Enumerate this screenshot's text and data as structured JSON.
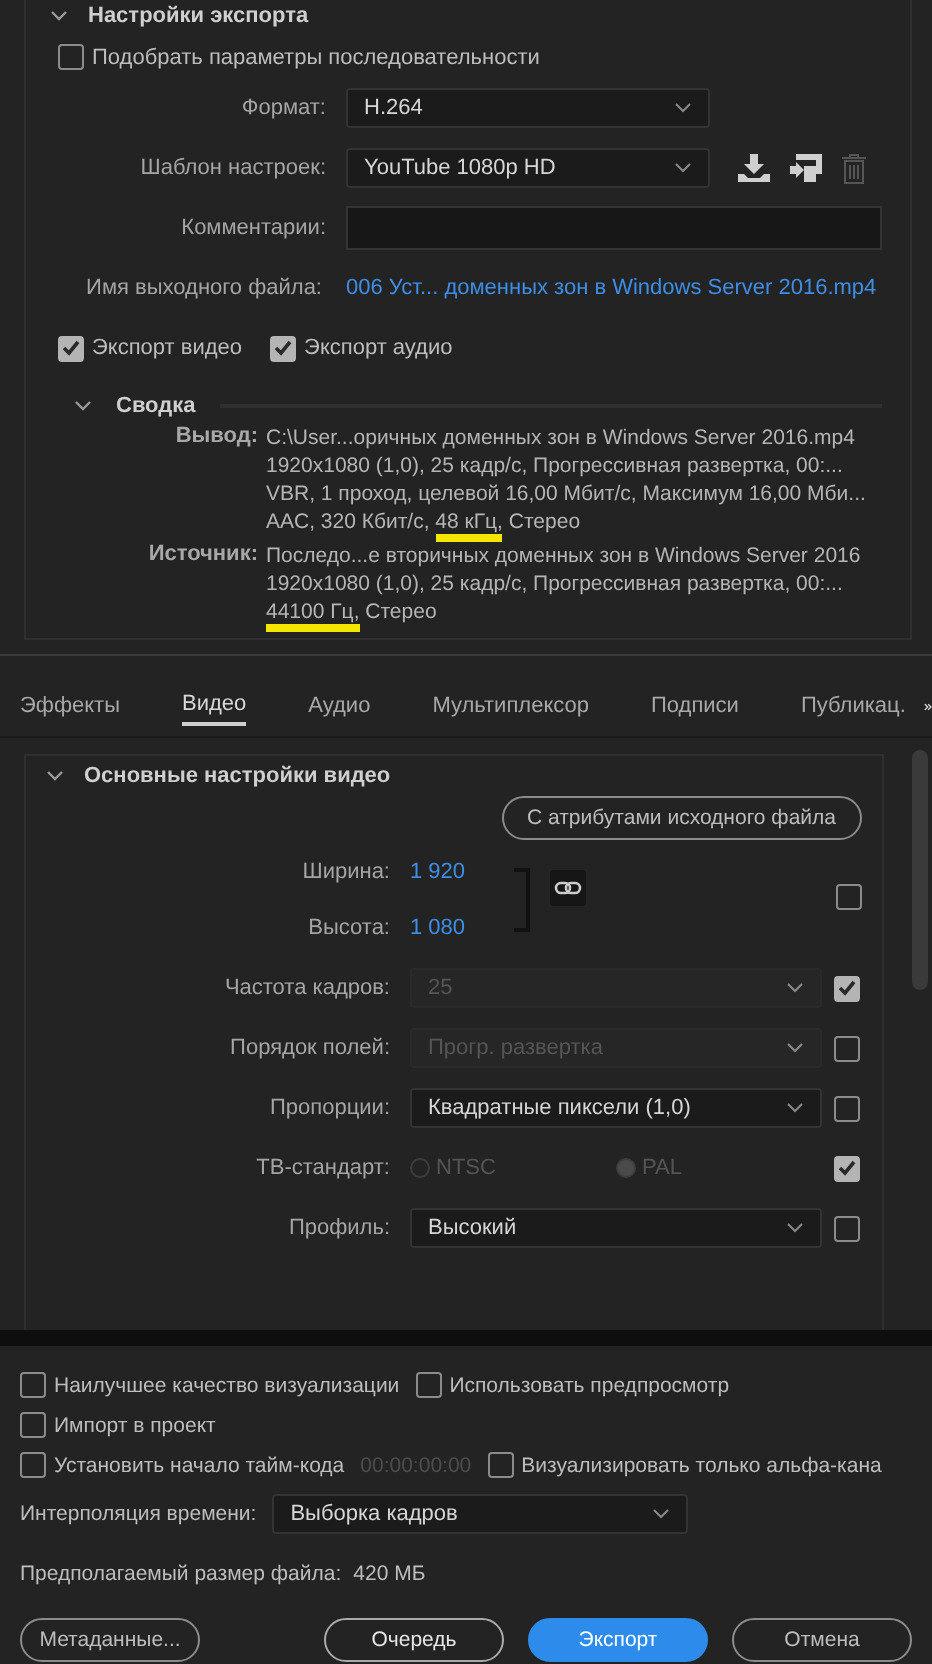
{
  "export_settings": {
    "title": "Настройки экспорта",
    "expanded": true,
    "match_sequence": {
      "label": "Подобрать параметры последовательности",
      "checked": false
    },
    "format": {
      "label": "Формат:",
      "value": "H.264"
    },
    "preset": {
      "label": "Шаблон настроек:",
      "value": "YouTube 1080p HD"
    },
    "comments": {
      "label": "Комментарии:"
    },
    "output_name": {
      "label": "Имя выходного файла:",
      "value": "006 Уст... доменных зон в Windows Server 2016.mp4"
    },
    "export_video": {
      "label": "Экспорт видео",
      "checked": true
    },
    "export_audio": {
      "label": "Экспорт аудио",
      "checked": true
    }
  },
  "summary": {
    "title": "Сводка",
    "expanded": true,
    "entries": [
      {
        "label": "Вывод:",
        "lines": [
          [
            {
              "text": "C:\\User...оричных доменных зон в Windows Server 2016.mp4",
              "highlighted": false
            }
          ],
          [
            {
              "text": "1920x1080 (1,0), 25 кадр/с, Прогрессивная развертка, 00:...",
              "highlighted": false
            }
          ],
          [
            {
              "text": "VBR, 1 проход, целевой 16,00 Мбит/с, Максимум 16,00 Мби...",
              "highlighted": false
            }
          ],
          [
            {
              "text": "AAC, 320 Кбит/с, ",
              "highlighted": false
            },
            {
              "text": "48 кГц,",
              "highlighted": true
            },
            {
              "text": " Стерео",
              "highlighted": false
            }
          ]
        ]
      },
      {
        "label": "Источник:",
        "lines": [
          [
            {
              "text": "Последо...е вторичных доменных зон в Windows Server 2016",
              "highlighted": false
            }
          ],
          [
            {
              "text": "1920x1080 (1,0), 25 кадр/с, Прогрессивная развертка, 00:...",
              "highlighted": false
            }
          ],
          [
            {
              "text": "44100 Гц,",
              "highlighted": true
            },
            {
              "text": " Стерео",
              "highlighted": false
            }
          ]
        ]
      }
    ]
  },
  "tabs": [
    {
      "label": "Эффекты",
      "selected": false
    },
    {
      "label": "Видео",
      "selected": true
    },
    {
      "label": "Аудио",
      "selected": false
    },
    {
      "label": "Мультиплексор",
      "selected": false
    },
    {
      "label": "Подписи",
      "selected": false
    },
    {
      "label": "Публикац.",
      "selected": false
    }
  ],
  "video": {
    "title": "Основные настройки видео",
    "expanded": true,
    "match_button": "С атрибутами исходного файла",
    "width": {
      "label": "Ширина:",
      "value": "1 920"
    },
    "height": {
      "label": "Высота:",
      "value": "1 080"
    },
    "dimensions_checked": false,
    "rows": [
      {
        "kind": "select",
        "label": "Частота кадров:",
        "value": "25",
        "disabled": true,
        "checked": true
      },
      {
        "kind": "select",
        "label": "Порядок полей:",
        "value": "Прогр. развертка",
        "disabled": true,
        "checked": false
      },
      {
        "kind": "select",
        "label": "Пропорции:",
        "value": "Квадратные пиксели (1,0)",
        "disabled": false,
        "checked": false
      },
      {
        "kind": "radio",
        "label": "ТВ-стандарт:",
        "options": [
          {
            "label": "NTSC",
            "selected": false
          },
          {
            "label": "PAL",
            "selected": true
          }
        ],
        "disabled": true,
        "checked": true
      },
      {
        "kind": "select",
        "label": "Профиль:",
        "value": "Высокий",
        "disabled": false,
        "checked": false
      }
    ]
  },
  "bottom": {
    "options": [
      [
        {
          "kind": "checkbox",
          "label": "Наилучшее качество визуализации",
          "checked": false
        },
        {
          "kind": "checkbox",
          "label": "Использовать предпросмотр",
          "checked": false
        }
      ],
      [
        {
          "kind": "checkbox",
          "label": "Импорт в проект",
          "checked": false
        }
      ],
      [
        {
          "kind": "checkbox",
          "label": "Установить начало тайм-кода",
          "checked": false
        },
        {
          "kind": "timecode",
          "value": "00:00:00:00",
          "disabled": true
        },
        {
          "kind": "checkbox",
          "label": "Визуализировать только альфа-кана",
          "checked": false
        }
      ]
    ],
    "interpolation": {
      "label": "Интерполяция времени:",
      "value": "Выборка кадров"
    },
    "file_size": {
      "label": "Предполагаемый размер файла:",
      "value": "420 МБ"
    },
    "buttons": [
      {
        "label": "Метаданные...",
        "kind": "outline"
      },
      {
        "label": "Очередь",
        "kind": "strong"
      },
      {
        "label": "Экспорт",
        "kind": "primary"
      },
      {
        "label": "Отмена",
        "kind": "outline"
      }
    ]
  }
}
